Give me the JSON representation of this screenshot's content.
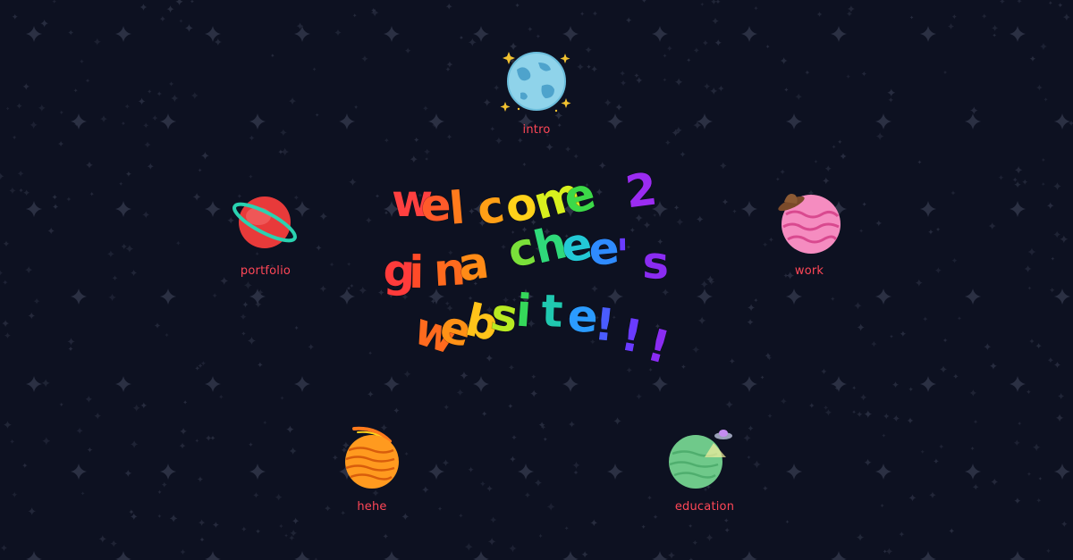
{
  "background": {
    "color": "#0d1121",
    "star_color": "#2f3447"
  },
  "title": {
    "lines": [
      {
        "text": "welcome 2",
        "chars": [
          {
            "c": "w",
            "color": "#ff4040"
          },
          {
            "c": "e",
            "color": "#ff5a2a"
          },
          {
            "c": "l",
            "color": "#ff7a1c"
          },
          {
            "c": "c",
            "color": "#ff9f16"
          },
          {
            "c": "o",
            "color": "#ffd21a"
          },
          {
            "c": "m",
            "color": "#d8f01e"
          },
          {
            "c": "e",
            "color": "#3cd948"
          },
          {
            "c": " ",
            "color": "#3cd948"
          },
          {
            "c": "2",
            "color": "#9b2cf2"
          }
        ]
      },
      {
        "text": "gina chee's",
        "chars": [
          {
            "c": "g",
            "color": "#ff3b3b"
          },
          {
            "c": "i",
            "color": "#ff4a28"
          },
          {
            "c": "n",
            "color": "#ff6a1e"
          },
          {
            "c": "a",
            "color": "#ff8b17"
          },
          {
            "c": " ",
            "color": "#ff8b17"
          },
          {
            "c": "c",
            "color": "#7ae03a"
          },
          {
            "c": "h",
            "color": "#2fd97a"
          },
          {
            "c": "e",
            "color": "#23c9d6"
          },
          {
            "c": "e",
            "color": "#2f8bff"
          },
          {
            "c": "'",
            "color": "#6a3bff"
          },
          {
            "c": "s",
            "color": "#8a2cf2"
          }
        ]
      },
      {
        "text": "website!!!",
        "chars": [
          {
            "c": "w",
            "color": "#ff6a1e"
          },
          {
            "c": "e",
            "color": "#ff9116"
          },
          {
            "c": "b",
            "color": "#ffc31a"
          },
          {
            "c": "s",
            "color": "#b8ea22"
          },
          {
            "c": "i",
            "color": "#35d85a"
          },
          {
            "c": "t",
            "color": "#20c8b0"
          },
          {
            "c": "e",
            "color": "#2b9bff"
          },
          {
            "c": "!",
            "color": "#4a5cff"
          },
          {
            "c": "!",
            "color": "#6a3bff"
          },
          {
            "c": "!",
            "color": "#8a2cf2"
          }
        ]
      }
    ]
  },
  "planets": {
    "intro": {
      "label": "intro",
      "color": "#8fd3ea",
      "accent": "#3e9bc6",
      "extra": "sparkles"
    },
    "portfolio": {
      "label": "portfolio",
      "color": "#e83a3a",
      "accent": "#2ad2b0",
      "extra": "ring"
    },
    "work": {
      "label": "work",
      "color": "#f58cc0",
      "accent": "#d9498f",
      "extra": "cowboy-hat"
    },
    "hehe": {
      "label": "hehe",
      "color": "#ff9a1f",
      "accent": "#d85d0c",
      "extra": "comet"
    },
    "education": {
      "label": "education",
      "color": "#6fc98a",
      "accent": "#3e9a5a",
      "extra": "ufo"
    }
  },
  "label_color": "#ff4757"
}
